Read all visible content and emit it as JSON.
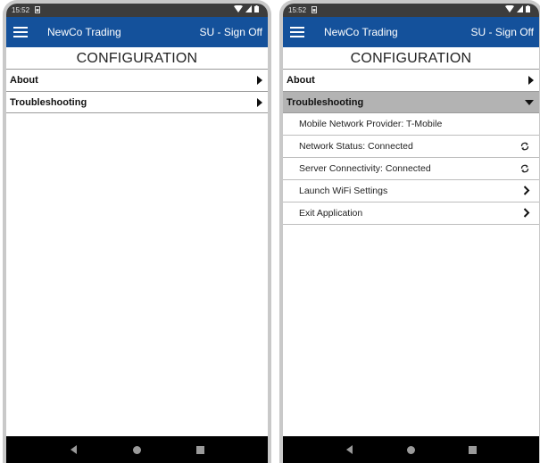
{
  "left": {
    "status": {
      "time": "15:52"
    },
    "appbar": {
      "title": "NewCo Trading",
      "signoff": "SU - Sign Off"
    },
    "page_title": "CONFIGURATION",
    "menu": [
      {
        "label": "About",
        "icon": "triangle-right-icon"
      },
      {
        "label": "Troubleshooting",
        "icon": "triangle-right-icon"
      }
    ]
  },
  "right": {
    "status": {
      "time": "15:52"
    },
    "appbar": {
      "title": "NewCo Trading",
      "signoff": "SU - Sign Off"
    },
    "page_title": "CONFIGURATION",
    "menu": [
      {
        "label": "About",
        "icon": "triangle-right-icon"
      },
      {
        "label": "Troubleshooting",
        "icon": "triangle-down-icon",
        "expanded": true
      }
    ],
    "troubleshooting_items": [
      {
        "label": "Mobile Network Provider: T-Mobile",
        "icon": ""
      },
      {
        "label": "Network Status: Connected",
        "icon": "sync-icon"
      },
      {
        "label": "Server Connectivity: Connected",
        "icon": "sync-icon"
      },
      {
        "label": "Launch WiFi Settings",
        "icon": "chevron-right-icon"
      },
      {
        "label": "Exit Application",
        "icon": "chevron-right-icon"
      }
    ]
  },
  "colors": {
    "appbar": "#14519b",
    "statusbar": "#3c3c3c",
    "expanded_row": "#b3b3b3",
    "navbar": "#000000"
  }
}
